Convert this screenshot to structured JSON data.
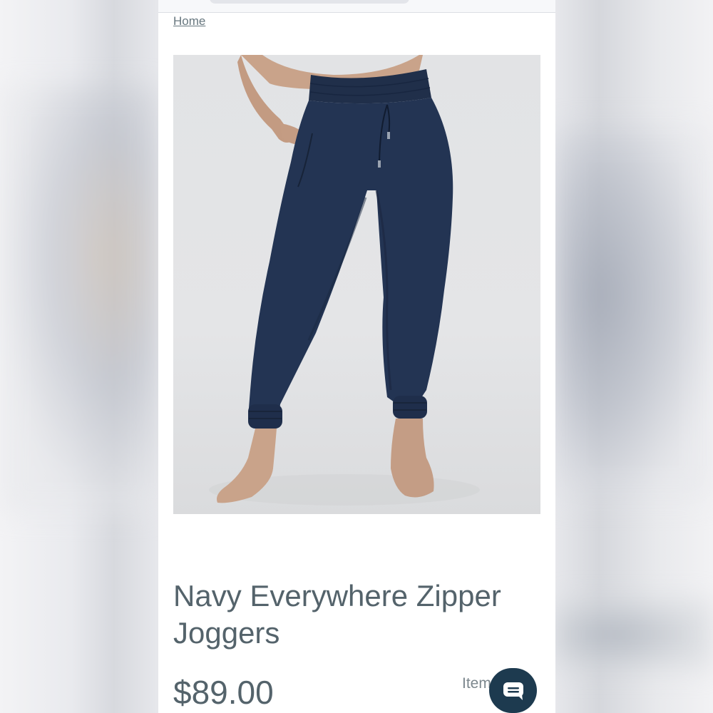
{
  "breadcrumb": {
    "home_label": "Home"
  },
  "product": {
    "title": "Navy Everywhere Zipper Joggers",
    "price": "$89.00",
    "item_label": "Item",
    "image_alt": "navy-joggers-product-photo"
  },
  "icons": {
    "chat": "chat-bubble-icon"
  },
  "colors": {
    "text": "#54636b",
    "navy_product": "#1f2f4a",
    "chat_button": "#1d3a4f"
  }
}
